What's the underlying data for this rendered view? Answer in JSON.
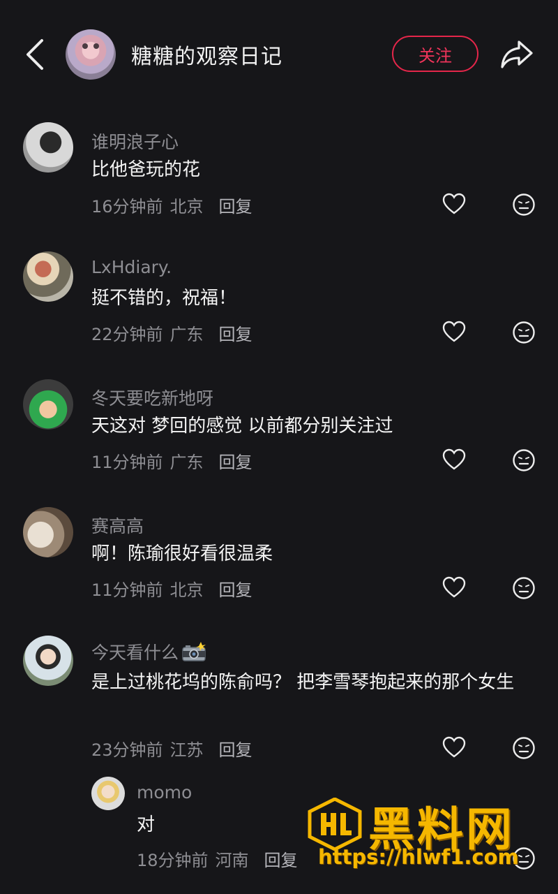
{
  "header": {
    "title": "糖糖的观察日记",
    "follow_label": "关注",
    "back_icon": "chevron-left-icon",
    "share_icon": "share-arrow-icon"
  },
  "comments": [
    {
      "name": "谁明浪子心",
      "text": "比他爸玩的花",
      "time": "16分钟前",
      "location": "北京",
      "reply": "回复"
    },
    {
      "name": "LxHdiary.",
      "text": "挺不错的，祝福！",
      "time": "22分钟前",
      "location": "广东",
      "reply": "回复"
    },
    {
      "name": "冬天要吃新地呀",
      "text": "天这对 梦回的感觉 以前都分别关注过",
      "time": "11分钟前",
      "location": "广东",
      "reply": "回复"
    },
    {
      "name": "赛高高",
      "text": "啊！陈瑜很好看很温柔",
      "time": "11分钟前",
      "location": "北京",
      "reply": "回复"
    },
    {
      "name": "今天看什么",
      "name_emoji": "camera-flash-icon",
      "text": "是上过桃花坞的陈俞吗？ 把李雪琴抱起来的那个女生",
      "time": "23分钟前",
      "location": "江苏",
      "reply": "回复"
    }
  ],
  "sub_reply": {
    "name": "momo",
    "text": "对",
    "time": "18分钟前",
    "location": "河南",
    "reply": "回复"
  },
  "watermark": {
    "big": "黑料网",
    "url": "https://hlwf1.com"
  },
  "colors": {
    "background": "#161619",
    "accent": "#E5264A",
    "watermark": "#F5B700",
    "muted_text": "#8E8E93"
  }
}
